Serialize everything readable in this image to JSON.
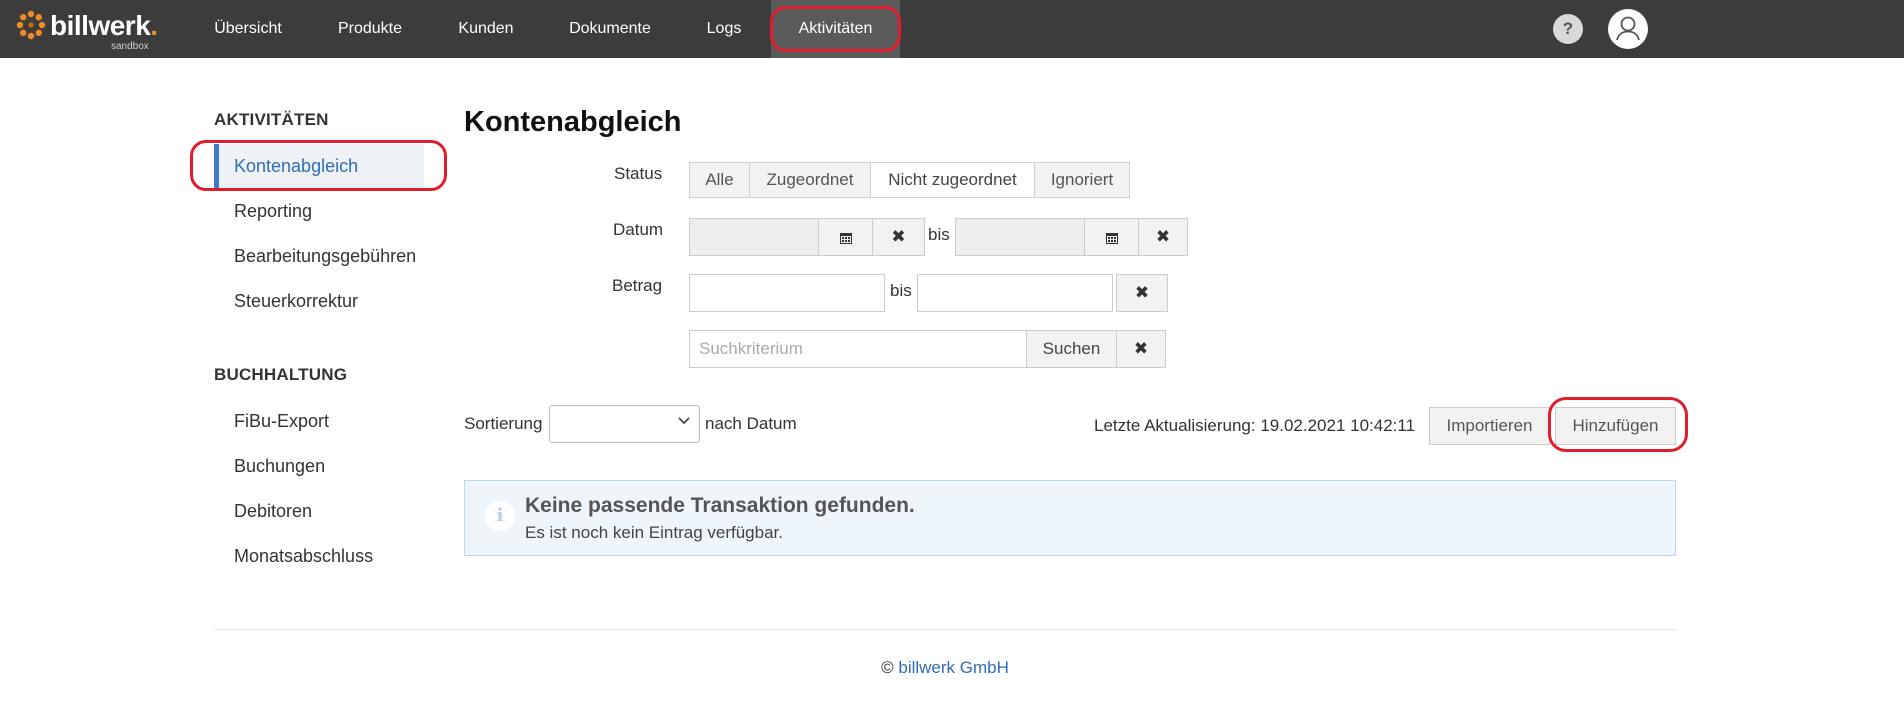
{
  "brand": {
    "name": "billwerk",
    "dot": ".",
    "sub": "sandbox",
    "accent_color": "#f08a24"
  },
  "nav": {
    "items": [
      "Übersicht",
      "Produkte",
      "Kunden",
      "Dokumente",
      "Logs",
      "Aktivitäten"
    ],
    "active": "Aktivitäten",
    "help": "?"
  },
  "sidebar": {
    "sections": [
      {
        "heading": "AKTIVITÄTEN",
        "items": [
          "Kontenabgleich",
          "Reporting",
          "Bearbeitungsgebühren",
          "Steuerkorrektur"
        ]
      },
      {
        "heading": "BUCHHALTUNG",
        "items": [
          "FiBu-Export",
          "Buchungen",
          "Debitoren",
          "Monatsabschluss"
        ]
      }
    ],
    "active": "Kontenabgleich"
  },
  "main": {
    "title": "Kontenabgleich",
    "filters": {
      "status_label": "Status",
      "status_options": [
        "Alle",
        "Zugeordnet",
        "Nicht zugeordnet",
        "Ignoriert"
      ],
      "status_selected": "Nicht zugeordnet",
      "date_label": "Datum",
      "date_from": "",
      "date_to": "",
      "amount_label": "Betrag",
      "amount_from": "",
      "amount_to": "",
      "range_sep": "bis",
      "search_placeholder": "Suchkriterium",
      "search_button": "Suchen"
    },
    "sort": {
      "label": "Sortierung",
      "value": "",
      "suffix": "nach Datum"
    },
    "last_update": "Letzte Aktualisierung: 19.02.2021 10:42:11",
    "import_button": "Importieren",
    "add_button": "Hinzufügen",
    "notice": {
      "title": "Keine passende Transaktion gefunden.",
      "text": "Es ist noch kein Eintrag verfügbar."
    }
  },
  "footer": {
    "copyright": "©",
    "company": "billwerk GmbH"
  },
  "icons": {
    "calendar": "calendar-icon",
    "clear": "clear-icon",
    "info": "info-icon",
    "help": "help-icon",
    "user": "user-icon",
    "chevron": "chevron-down-icon"
  }
}
